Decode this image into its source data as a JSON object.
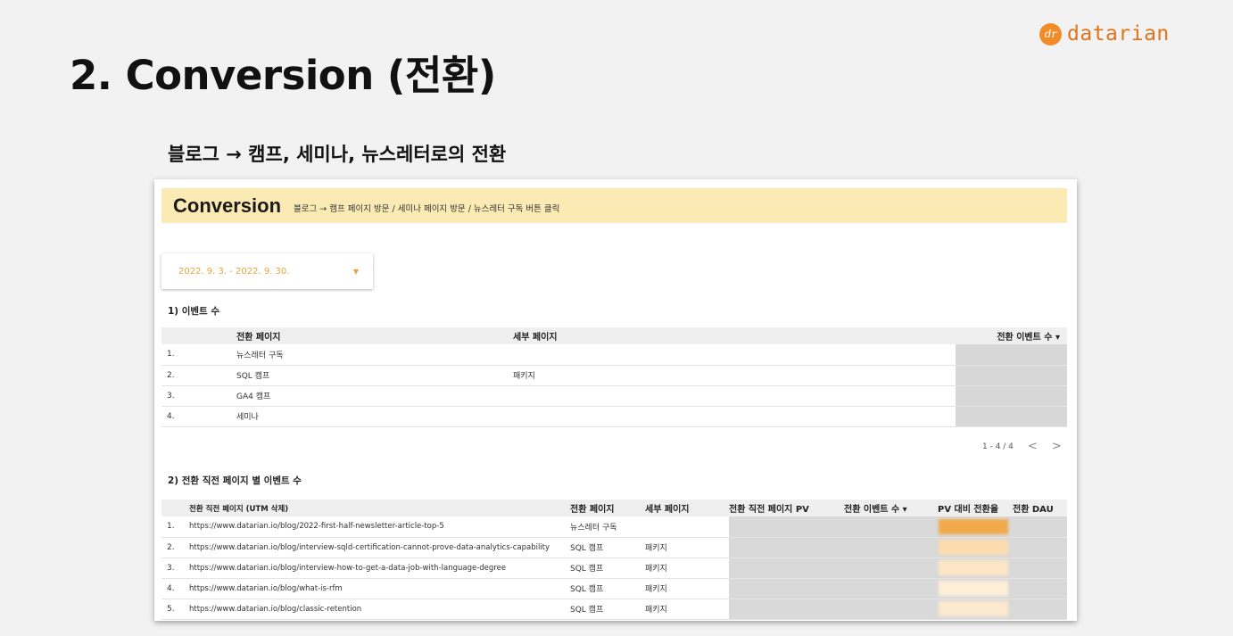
{
  "brand": {
    "mark": "dr",
    "name": "datarian"
  },
  "slide": {
    "title": "2. Conversion (전환)",
    "subtitle": "블로그 → 캠프, 세미나, 뉴스레터로의 전환"
  },
  "report": {
    "title": "Conversion",
    "description": "블로그 → 캠프 페이지 방문 / 세미나 페이지 방문 / 뉴스레터 구독 버튼 클릭",
    "date_range": "2022. 9. 3. - 2022. 9. 30.",
    "section1_label": "1) 이벤트 수",
    "section2_label": "2) 전환 직전 페이지 별 이벤트 수",
    "table1": {
      "headers": {
        "page": "전환 페이지",
        "detail": "세부 페이지",
        "events": "전환 이벤트 수 ▾"
      },
      "rows": [
        {
          "num": "1.",
          "page": "뉴스레터 구독",
          "detail": ""
        },
        {
          "num": "2.",
          "page": "SQL 캠프",
          "detail": "패키지"
        },
        {
          "num": "3.",
          "page": "GA4 캠프",
          "detail": ""
        },
        {
          "num": "4.",
          "page": "세미나",
          "detail": ""
        }
      ],
      "pagination": "1 - 4 / 4",
      "prev": "<",
      "next": ">"
    },
    "table2": {
      "headers": {
        "url": "전환 직전 페이지 (UTM 삭제)",
        "conv": "전환 페이지",
        "sub": "세부 페이지",
        "pv": "전환 직전 페이지 PV",
        "ev": "전환 이벤트 수 ▾",
        "rate": "PV 대비 전환율",
        "dau": "전환 DAU"
      },
      "rows": [
        {
          "num": "1.",
          "url": "https://www.datarian.io/blog/2022-first-half-newsletter-article-top-5",
          "conv": "뉴스레터 구독",
          "sub": ""
        },
        {
          "num": "2.",
          "url": "https://www.datarian.io/blog/interview-sqld-certification-cannot-prove-data-analytics-capability",
          "conv": "SQL 캠프",
          "sub": "패키지"
        },
        {
          "num": "3.",
          "url": "https://www.datarian.io/blog/interview-how-to-get-a-data-job-with-language-degree",
          "conv": "SQL 캠프",
          "sub": "패키지"
        },
        {
          "num": "4.",
          "url": "https://www.datarian.io/blog/what-is-rfm",
          "conv": "SQL 캠프",
          "sub": "패키지"
        },
        {
          "num": "5.",
          "url": "https://www.datarian.io/blog/classic-retention",
          "conv": "SQL 캠프",
          "sub": "패키지"
        }
      ]
    },
    "heat_colors": [
      "#f2a94a",
      "#fbdcae",
      "#fde6c4",
      "#fdeed8",
      "#fde9cf"
    ]
  }
}
